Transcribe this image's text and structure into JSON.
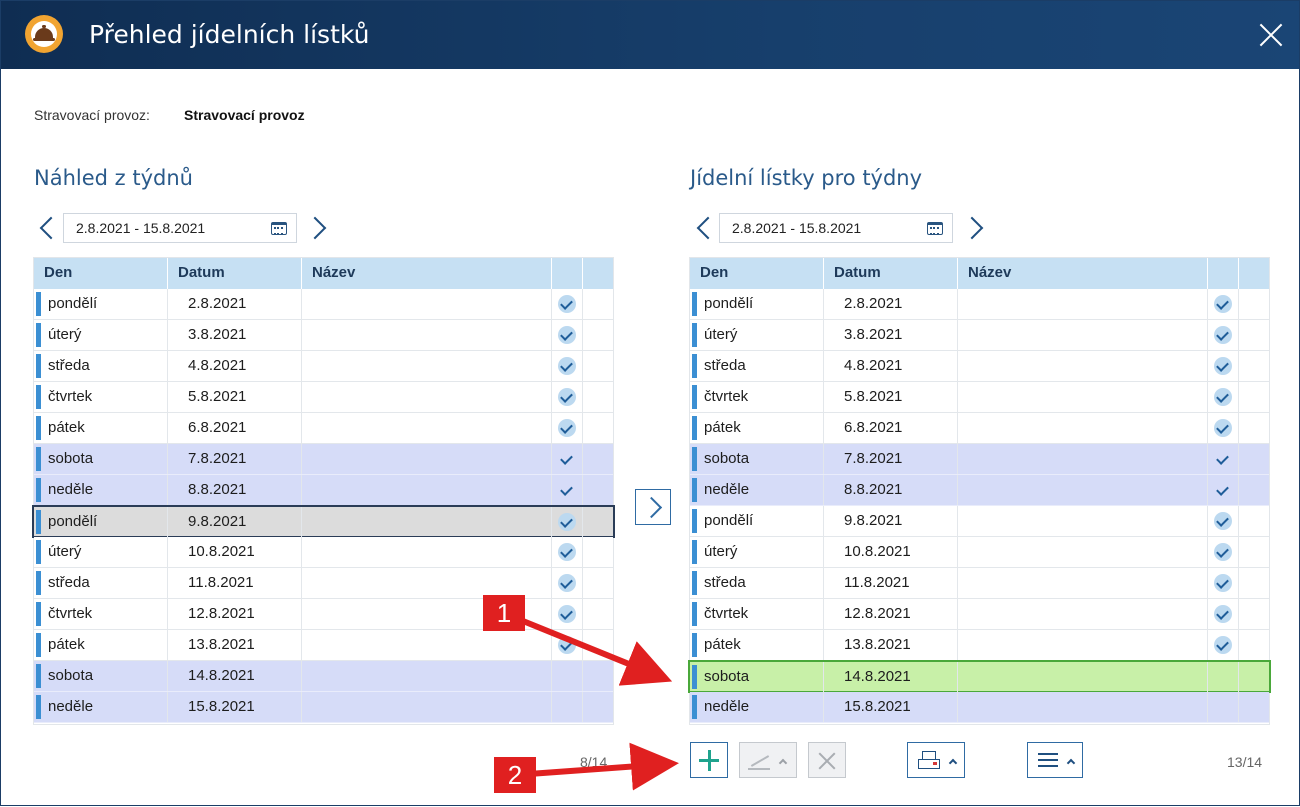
{
  "window": {
    "title": "Přehled jídelních lístků"
  },
  "facility": {
    "label": "Stravovací provoz:",
    "value": "Stravovací provoz"
  },
  "left_panel": {
    "title": "Náhled z týdnů",
    "date_range": "2.8.2021 - 15.8.2021",
    "columns": [
      "Den",
      "Datum",
      "Název"
    ],
    "counter": "8/14",
    "rows": [
      {
        "day": "pondělí",
        "date": "2.8.2021",
        "name": "",
        "checked": true,
        "weekend": false
      },
      {
        "day": "úterý",
        "date": "3.8.2021",
        "name": "",
        "checked": true,
        "weekend": false
      },
      {
        "day": "středa",
        "date": "4.8.2021",
        "name": "",
        "checked": true,
        "weekend": false
      },
      {
        "day": "čtvrtek",
        "date": "5.8.2021",
        "name": "",
        "checked": true,
        "weekend": false
      },
      {
        "day": "pátek",
        "date": "6.8.2021",
        "name": "",
        "checked": true,
        "weekend": false
      },
      {
        "day": "sobota",
        "date": "7.8.2021",
        "name": "",
        "checked": true,
        "weekend": true
      },
      {
        "day": "neděle",
        "date": "8.8.2021",
        "name": "",
        "checked": true,
        "weekend": true
      },
      {
        "day": "pondělí",
        "date": "9.8.2021",
        "name": "",
        "checked": true,
        "weekend": false,
        "selected": true
      },
      {
        "day": "úterý",
        "date": "10.8.2021",
        "name": "",
        "checked": true,
        "weekend": false
      },
      {
        "day": "středa",
        "date": "11.8.2021",
        "name": "",
        "checked": true,
        "weekend": false
      },
      {
        "day": "čtvrtek",
        "date": "12.8.2021",
        "name": "",
        "checked": true,
        "weekend": false
      },
      {
        "day": "pátek",
        "date": "13.8.2021",
        "name": "",
        "checked": true,
        "weekend": false
      },
      {
        "day": "sobota",
        "date": "14.8.2021",
        "name": "",
        "checked": false,
        "weekend": true
      },
      {
        "day": "neděle",
        "date": "15.8.2021",
        "name": "",
        "checked": false,
        "weekend": true
      }
    ]
  },
  "right_panel": {
    "title": "Jídelní lístky pro týdny",
    "date_range": "2.8.2021 - 15.8.2021",
    "columns": [
      "Den",
      "Datum",
      "Název"
    ],
    "counter": "13/14",
    "rows": [
      {
        "day": "pondělí",
        "date": "2.8.2021",
        "name": "",
        "checked": true,
        "weekend": false
      },
      {
        "day": "úterý",
        "date": "3.8.2021",
        "name": "",
        "checked": true,
        "weekend": false
      },
      {
        "day": "středa",
        "date": "4.8.2021",
        "name": "",
        "checked": true,
        "weekend": false
      },
      {
        "day": "čtvrtek",
        "date": "5.8.2021",
        "name": "",
        "checked": true,
        "weekend": false
      },
      {
        "day": "pátek",
        "date": "6.8.2021",
        "name": "",
        "checked": true,
        "weekend": false
      },
      {
        "day": "sobota",
        "date": "7.8.2021",
        "name": "",
        "checked": true,
        "weekend": true
      },
      {
        "day": "neděle",
        "date": "8.8.2021",
        "name": "",
        "checked": true,
        "weekend": true
      },
      {
        "day": "pondělí",
        "date": "9.8.2021",
        "name": "",
        "checked": true,
        "weekend": false
      },
      {
        "day": "úterý",
        "date": "10.8.2021",
        "name": "",
        "checked": true,
        "weekend": false
      },
      {
        "day": "středa",
        "date": "11.8.2021",
        "name": "",
        "checked": true,
        "weekend": false
      },
      {
        "day": "čtvrtek",
        "date": "12.8.2021",
        "name": "",
        "checked": true,
        "weekend": false
      },
      {
        "day": "pátek",
        "date": "13.8.2021",
        "name": "",
        "checked": true,
        "weekend": false
      },
      {
        "day": "sobota",
        "date": "14.8.2021",
        "name": "",
        "checked": false,
        "weekend": true,
        "highlight": true
      },
      {
        "day": "neděle",
        "date": "15.8.2021",
        "name": "",
        "checked": false,
        "weekend": true
      }
    ]
  },
  "toolbar": {
    "add_icon": "plus-icon",
    "edit_icon": "pencil-icon",
    "delete_icon": "x-icon",
    "print_icon": "printer-icon",
    "menu_icon": "hamburger-icon"
  },
  "callouts": {
    "one": "1",
    "two": "2"
  },
  "colors": {
    "titlebar": "#0f2d52",
    "accent": "#3b8fd3",
    "header": "#c6e0f3",
    "weekend_row": "#d6dcf8",
    "highlight_row": "#c8f0a8",
    "callout": "#e02020"
  }
}
